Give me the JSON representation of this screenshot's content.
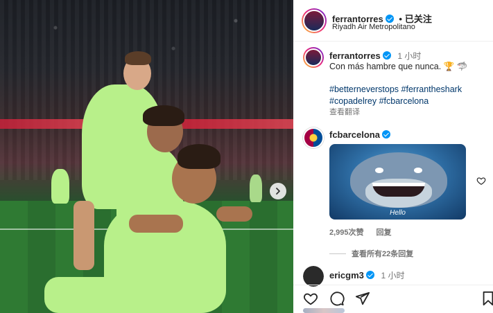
{
  "post": {
    "author": "ferrantorres",
    "follow_status": "已关注",
    "location": "Riyadh Air Metropolitano",
    "separator": "•",
    "slide_control": "next-arrow"
  },
  "caption": {
    "username": "ferrantorres",
    "time": "1 小时",
    "text": "Con más hambre que nunca.",
    "emoji": "🏆 🦈",
    "hashtags_line1": "#betterneverstops #ferrantheshark",
    "hashtags_line2": "#copadelrey #fcbarcelona",
    "translate": "查看翻译"
  },
  "comment": {
    "username": "fcbarcelona",
    "gif_caption": "Hello",
    "likes": "2,995次赞",
    "reply": "回复",
    "view_replies": "查看所有22条回复"
  },
  "next_comment": {
    "username": "ericgm3",
    "time": "1 小时"
  },
  "actions": [
    "like",
    "comment",
    "share",
    "save"
  ],
  "colors": {
    "verified": "#0095f6",
    "jersey": "#b8f08a",
    "link": "#00376b",
    "muted": "#737373"
  }
}
